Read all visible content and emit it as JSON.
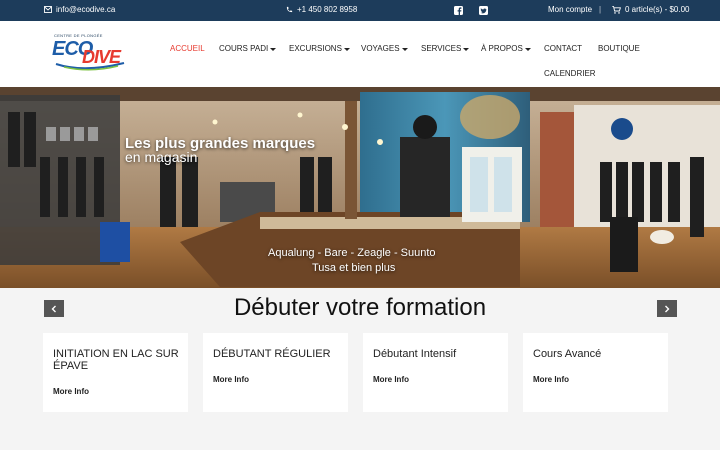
{
  "topbar": {
    "email": "info@ecodive.ca",
    "phone": "+1 450 802 8958",
    "account": "Mon compte",
    "separator": "|",
    "cart": "0 article(s) - $0.00"
  },
  "logo": {
    "tagline": "CENTRE DE PLONGÉE",
    "word1": "ECO",
    "word2": "DIVE"
  },
  "nav": {
    "items": [
      {
        "label": "ACCUEIL",
        "active": true
      },
      {
        "label": "COURS PADI",
        "dropdown": true
      },
      {
        "label": "EXCURSIONS",
        "dropdown": true
      },
      {
        "label": "VOYAGES",
        "dropdown": true
      },
      {
        "label": "SERVICES",
        "dropdown": true
      },
      {
        "label": "À PROPOS",
        "dropdown": true
      },
      {
        "label": "CONTACT"
      },
      {
        "label": "BOUTIQUE"
      },
      {
        "label": "CALENDRIER"
      }
    ]
  },
  "hero": {
    "headline": "Les plus grandes marques",
    "subheadline": "en magasin",
    "brands_line1": "Aqualung - Bare - Zeagle - Suunto",
    "brands_line2": "Tusa et bien plus"
  },
  "section": {
    "title": "Débuter votre formation"
  },
  "cards": [
    {
      "title": "INITIATION EN LAC SUR ÉPAVE",
      "more": "More Info"
    },
    {
      "title": "DÉBUTANT RÉGULIER",
      "more": "More Info"
    },
    {
      "title": "Débutant Intensif",
      "more": "More Info"
    },
    {
      "title": "Cours Avancé",
      "more": "More Info"
    }
  ],
  "colors": {
    "topbar_bg": "#1d3c5b",
    "accent_red": "#e73a2f",
    "logo_blue": "#1e5da8"
  }
}
